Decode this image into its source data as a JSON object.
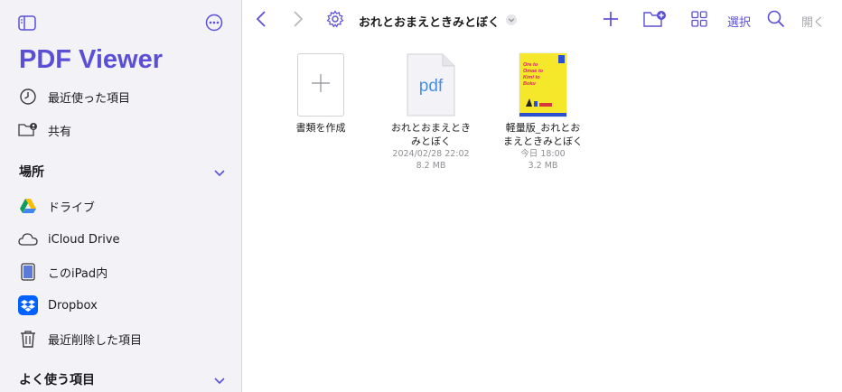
{
  "app": {
    "title": "PDF Viewer"
  },
  "sidebar": {
    "top_icons": [
      "sidebar-toggle-icon",
      "more-ellipsis-icon"
    ],
    "favorites": [
      {
        "label": "最近使った項目",
        "icon": "clock-icon"
      },
      {
        "label": "共有",
        "icon": "shared-folder-icon"
      }
    ],
    "locations_header": "場所",
    "locations": [
      {
        "label": "ドライブ",
        "icon": "google-drive-icon"
      },
      {
        "label": "iCloud Drive",
        "icon": "cloud-icon"
      },
      {
        "label": "このiPad内",
        "icon": "ipad-icon"
      },
      {
        "label": "Dropbox",
        "icon": "dropbox-icon"
      },
      {
        "label": "最近削除した項目",
        "icon": "trash-icon"
      }
    ],
    "favorites_header": "よく使う項目"
  },
  "toolbar": {
    "folder_title": "おれとおまえときみとぼく",
    "select_label": "選択",
    "open_label": "開く",
    "icons": [
      "back-chevron-icon",
      "forward-chevron-icon",
      "gear-icon",
      "plus-icon",
      "new-folder-icon",
      "grid-view-icon",
      "search-icon"
    ]
  },
  "files": [
    {
      "name": "書類を作成",
      "kind": "create"
    },
    {
      "name": "おれとおまえとき\nみとぼく",
      "date": "2024/02/28 22:02",
      "size": "8.2 MB",
      "kind": "pdf",
      "thumb_label": "pdf"
    },
    {
      "name": "軽量版_おれとお\nまえときみとぼく",
      "date": "今日 18:00",
      "size": "3.2 MB",
      "kind": "cover",
      "cover_text": "Ore to\nOmae to\nKimi to\nBoku"
    }
  ],
  "colors": {
    "accent": "#5b4fd6",
    "sidebar_bg": "#f2f2f7",
    "pdf_blue": "#4a8fe0",
    "cover_yellow": "#f5e82a"
  }
}
